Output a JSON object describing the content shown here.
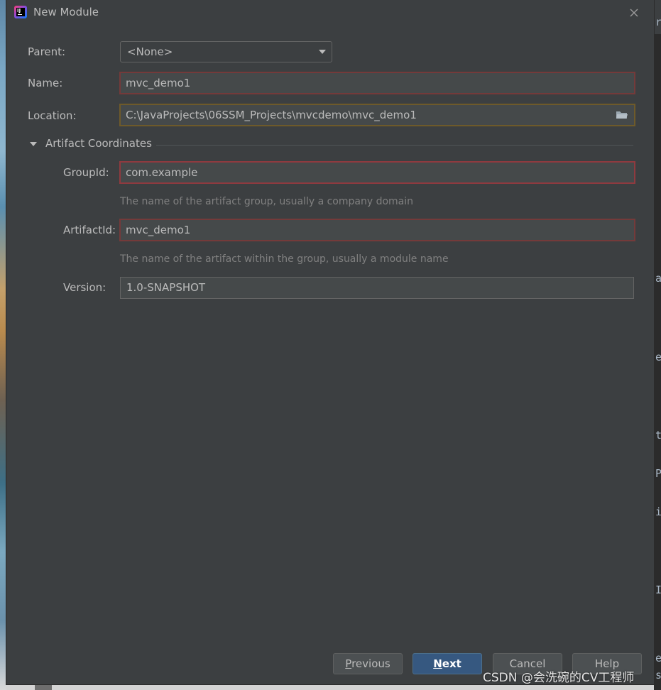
{
  "window": {
    "title": "New Module"
  },
  "form": {
    "parent": {
      "label": "Parent:",
      "value": "<None>"
    },
    "name": {
      "label": "Name:",
      "value": "mvc_demo1"
    },
    "location": {
      "label": "Location:",
      "value": "C:\\JavaProjects\\06SSM_Projects\\mvcdemo\\mvc_demo1"
    }
  },
  "artifact": {
    "section_title": "Artifact Coordinates",
    "group_id": {
      "label": "GroupId:",
      "value": "com.example",
      "hint": "The name of the artifact group, usually a company domain"
    },
    "artifact_id": {
      "label": "ArtifactId:",
      "value": "mvc_demo1",
      "hint": "The name of the artifact within the group, usually a module name"
    },
    "version": {
      "label": "Version:",
      "value": "1.0-SNAPSHOT"
    }
  },
  "buttons": {
    "previous": {
      "mnemonic": "P",
      "rest": "revious"
    },
    "next": {
      "mnemonic": "N",
      "rest": "ext"
    },
    "cancel": "Cancel",
    "help": "Help"
  },
  "watermark": "CSDN @会洗碗的CV工程师",
  "background": {
    "right_glyphs": [
      "re",
      "a",
      "e",
      "t",
      "P",
      "i",
      "I",
      "ev",
      "s"
    ]
  },
  "colors": {
    "dialog_bg": "#3c3f41",
    "field_bg": "#45494a",
    "error_border": "#743a3a",
    "warning_border": "#6e5a2a",
    "primary_button": "#365880"
  },
  "icons": {
    "app": "intellij-idea-icon",
    "close": "close-icon",
    "folder": "folder-icon",
    "dropdown": "chevron-down-icon",
    "section_toggle": "triangle-down-icon"
  }
}
